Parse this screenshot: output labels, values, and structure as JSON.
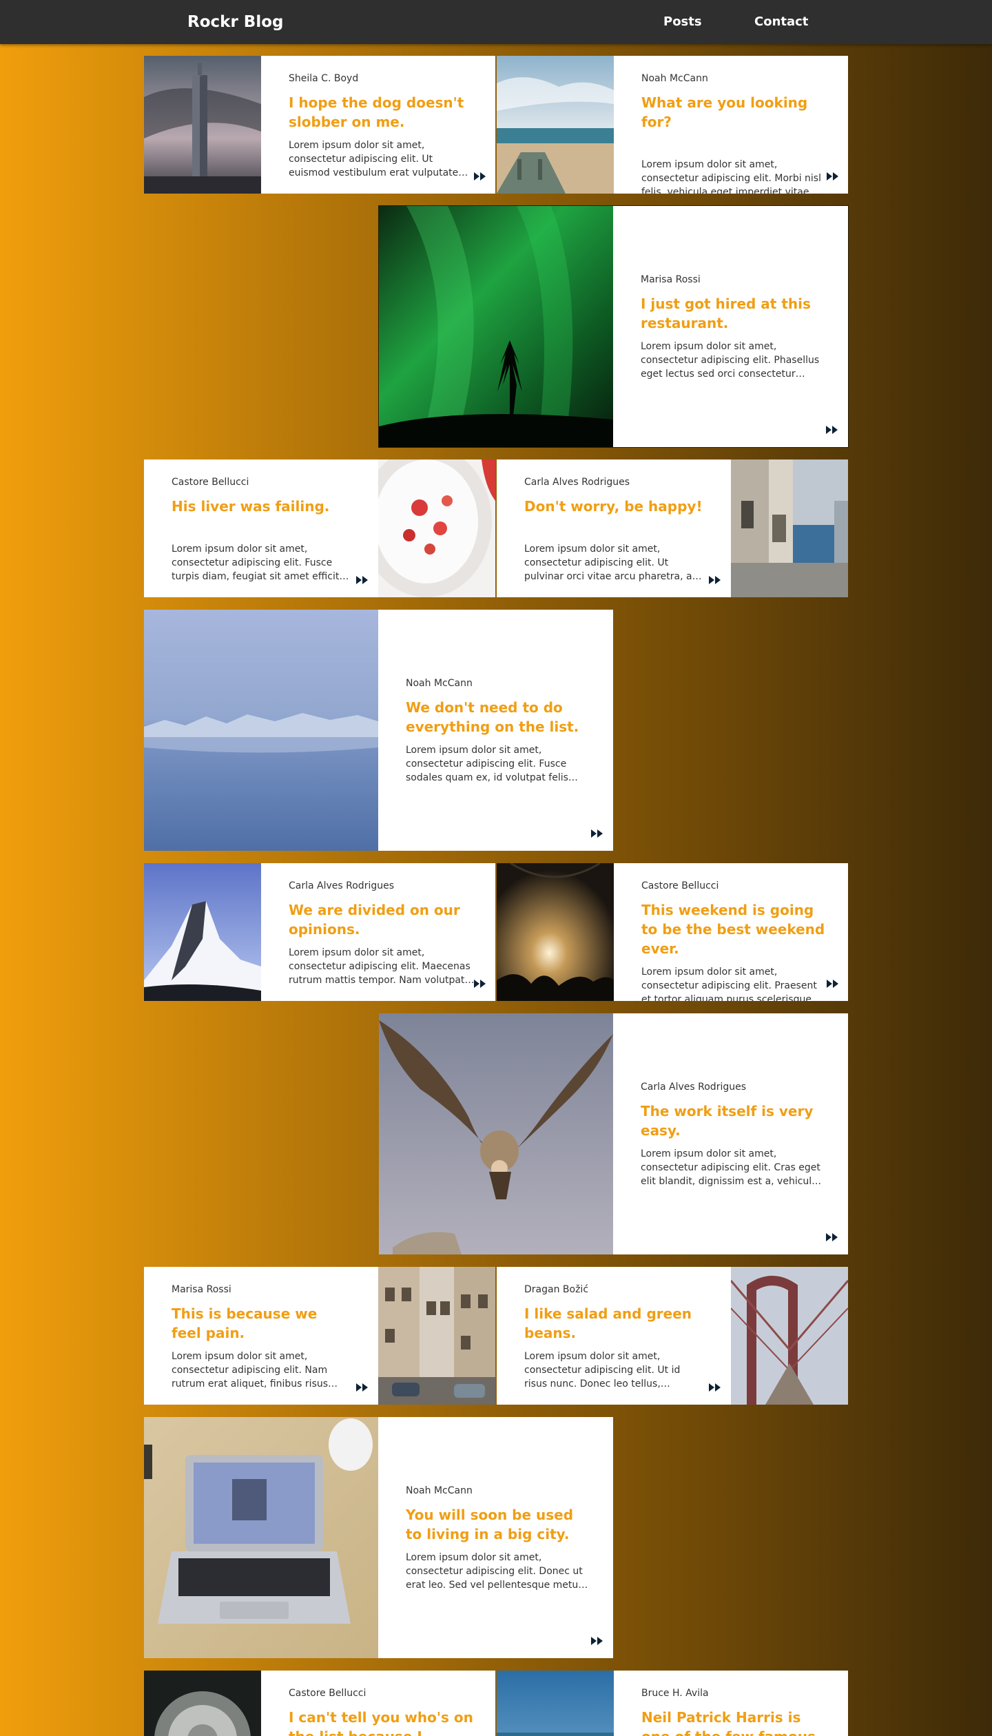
{
  "header": {
    "brand": "Rockr Blog",
    "nav": {
      "posts": "Posts",
      "contact": "Contact"
    }
  },
  "colors": {
    "header_bg": "#2f2f2f",
    "title_accent": "#f09e14",
    "read_more_icon": "#0e2236",
    "bg_gradient_start": "#f09e0c",
    "bg_gradient_end": "#3d2a08"
  },
  "posts": [
    {
      "author": "Sheila C. Boyd",
      "title": "I hope the dog doesn't slobber on me.",
      "excerpt": "Lorem ipsum dolor sit amet, consectetur adipiscing elit. Ut euismod vestibulum erat vulputate semper, nec tincidunt leo.",
      "image": "skyscraper-photo"
    },
    {
      "author": "Noah McCann",
      "title": "What are you looking for?",
      "excerpt": "Lorem ipsum dolor sit amet, consectetur adipiscing elit. Morbi nisl felis, vehicula eget imperdiet vitae, tempus sed diam.",
      "image": "beach-boardwalk-photo"
    },
    {
      "author": "Marisa Rossi",
      "title": "I just got hired at this restaurant.",
      "excerpt": "Lorem ipsum dolor sit amet, consectetur adipiscing elit. Phasellus eget lectus sed orci consectetur tincidunt vel ut nunc.",
      "image": "aurora-forest-photo"
    },
    {
      "author": "Castore Bellucci",
      "title": "His liver was failing.",
      "excerpt": "Lorem ipsum dolor sit amet, consectetur adipiscing elit. Fusce turpis diam, feugiat sit amet efficitur ac, aliquam at nunc.",
      "image": "strawberry-yogurt-photo"
    },
    {
      "author": "Carla Alves Rodrigues",
      "title": "Don't worry, be happy!",
      "excerpt": "Lorem ipsum dolor sit amet, consectetur adipiscing elit. Ut pulvinar orci vitae arcu pharetra, ac dictum ante porttitor.",
      "image": "seaside-alley-photo"
    },
    {
      "author": "Noah McCann",
      "title": "We don't need to do everything on the list.",
      "excerpt": "Lorem ipsum dolor sit amet, consectetur adipiscing elit. Fusce sodales quam ex, id volutpat felis dictum quis.",
      "image": "glacier-lake-photo"
    },
    {
      "author": "Carla Alves Rodrigues",
      "title": "We are divided on our opinions.",
      "excerpt": "Lorem ipsum dolor sit amet, consectetur adipiscing elit. Maecenas rutrum mattis tempor. Nam volutpat massa ut ligula.",
      "image": "matterhorn-photo"
    },
    {
      "author": "Castore Bellucci",
      "title": "This weekend is going to be the best weekend ever.",
      "excerpt": "Lorem ipsum dolor sit amet, consectetur adipiscing elit. Praesent et tortor aliquam purus scelerisque tristique.",
      "image": "concert-crowd-photo"
    },
    {
      "author": "Carla Alves Rodrigues",
      "title": "The work itself is very easy.",
      "excerpt": "Lorem ipsum dolor sit amet, consectetur adipiscing elit. Cras eget elit blandit, dignissim est a, vehicula neque.",
      "image": "vulture-flight-photo"
    },
    {
      "author": "Marisa Rossi",
      "title": "This is because we feel pain.",
      "excerpt": "Lorem ipsum dolor sit amet, consectetur adipiscing elit. Nam rutrum erat aliquet, finibus risus sed, auctor purus.",
      "image": "old-town-street-photo"
    },
    {
      "author": "Dragan Božić",
      "title": "I like salad and green beans.",
      "excerpt": "Lorem ipsum dolor sit amet, consectetur adipiscing elit. Ut id risus nunc. Donec leo tellus, tincidunt ut nibh quis.",
      "image": "brooklyn-bridge-photo"
    },
    {
      "author": "Noah McCann",
      "title": "You will soon be used to living in a big city.",
      "excerpt": "Lorem ipsum dolor sit amet, consectetur adipiscing elit. Donec ut erat leo. Sed vel pellentesque metus, sit amet tincidunt.",
      "image": "laptop-desk-photo"
    },
    {
      "author": "Castore Bellucci",
      "title": "I can't tell you who's on the list because I haven'",
      "excerpt": "",
      "image": "dandelion-photo"
    },
    {
      "author": "Bruce H. Avila",
      "title": "Neil Patrick Harris is one of the few famous peopl",
      "excerpt": "",
      "image": "ocean-sky-photo"
    }
  ]
}
